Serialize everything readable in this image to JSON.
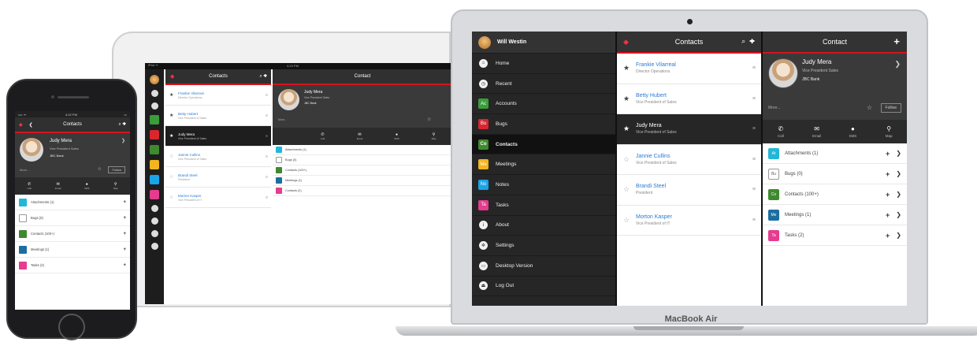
{
  "colors": {
    "accent": "#d6141d",
    "link": "#2a7bd3",
    "accounts": "#3a9d3a",
    "bugs": "#d9262f",
    "contacts": "#3f8a2f",
    "meetings": "#f2b51d",
    "notes": "#1ba3e8",
    "tasks": "#e63b8e",
    "attachments": "#21b7d8"
  },
  "laptop": {
    "brand": "MacBook Air",
    "menu": {
      "user": "Will Westin",
      "items": [
        {
          "label": "Home",
          "icon": "home-icon"
        },
        {
          "label": "Recent",
          "icon": "clock-icon"
        },
        {
          "label": "Accounts",
          "icon": "accounts-icon"
        },
        {
          "label": "Bugs",
          "icon": "bugs-icon"
        },
        {
          "label": "Contacts",
          "icon": "contacts-icon"
        },
        {
          "label": "Meetings",
          "icon": "meetings-icon"
        },
        {
          "label": "Notes",
          "icon": "notes-icon"
        },
        {
          "label": "Tasks",
          "icon": "tasks-icon"
        },
        {
          "label": "About",
          "icon": "info-icon"
        },
        {
          "label": "Settings",
          "icon": "gear-icon"
        },
        {
          "label": "Desktop Version",
          "icon": "monitor-icon"
        },
        {
          "label": "Log Out",
          "icon": "logout-icon"
        }
      ]
    },
    "list": {
      "title": "Contacts",
      "contacts": [
        {
          "name": "Frankie Vilarreal",
          "title": "Director Operations",
          "starred": true
        },
        {
          "name": "Betty Hubert",
          "title": "Vice President of Sales",
          "starred": true
        },
        {
          "name": "Judy Mera",
          "title": "Vice President of Sales",
          "starred": true
        },
        {
          "name": "Jannie Cullins",
          "title": "Vice President of Sales",
          "starred": false
        },
        {
          "name": "Brandi Steel",
          "title": "President",
          "starred": false
        },
        {
          "name": "Morton Kasper",
          "title": "Vice President of IT",
          "starred": false
        }
      ]
    },
    "detail": {
      "title": "Contact",
      "name": "Judy Mera",
      "job": "Vice President Sales",
      "company": "JBC Bank",
      "more": "More...",
      "follow": "Follow",
      "actions": [
        "Call",
        "Email",
        "SMS",
        "Map"
      ],
      "related": [
        {
          "label": "Attachments (1)",
          "badge": "At"
        },
        {
          "label": "Bugs (0)",
          "badge": "Bu"
        },
        {
          "label": "Contacts (100+)",
          "badge": "Co"
        },
        {
          "label": "Meetings (1)",
          "badge": "Me"
        },
        {
          "label": "Tasks (2)",
          "badge": "Ta"
        }
      ]
    }
  },
  "tablet": {
    "time": "4:24 PM",
    "list": {
      "title": "Contacts",
      "contacts": [
        {
          "name": "Frankie Vilarreal",
          "title": "Director Operations"
        },
        {
          "name": "Betty Hubert",
          "title": "Vice President of Sales"
        },
        {
          "name": "Judy Mera",
          "title": "Vice President of Sales"
        },
        {
          "name": "Jannie Cullins",
          "title": "Vice President of Sales"
        },
        {
          "name": "Brandi Steel",
          "title": "President"
        },
        {
          "name": "Morton Kasper",
          "title": "Vice President of IT"
        }
      ]
    },
    "detail": {
      "title": "Contact",
      "name": "Judy Mera",
      "job": "Vice President Sales",
      "company": "JBC Bank",
      "more": "More...",
      "actions": [
        "Call",
        "Email",
        "SMS",
        "Map"
      ],
      "related": [
        "Attachments (1)",
        "Bugs (0)",
        "Contacts (100+)",
        "Meetings (1)",
        "Contacts (2)"
      ]
    }
  },
  "phone": {
    "time": "4:22 PM",
    "title": "Contacts",
    "name": "Judy Mera",
    "job": "Vice President Sales",
    "company": "JBC Bank",
    "more": "More...",
    "follow": "Follow",
    "actions": [
      "Call",
      "Email",
      "SMS",
      "Map"
    ],
    "related": [
      "Attachments (1)",
      "Bugs (0)",
      "Contacts (100+)",
      "Meetings (1)",
      "Tasks (2)"
    ]
  }
}
